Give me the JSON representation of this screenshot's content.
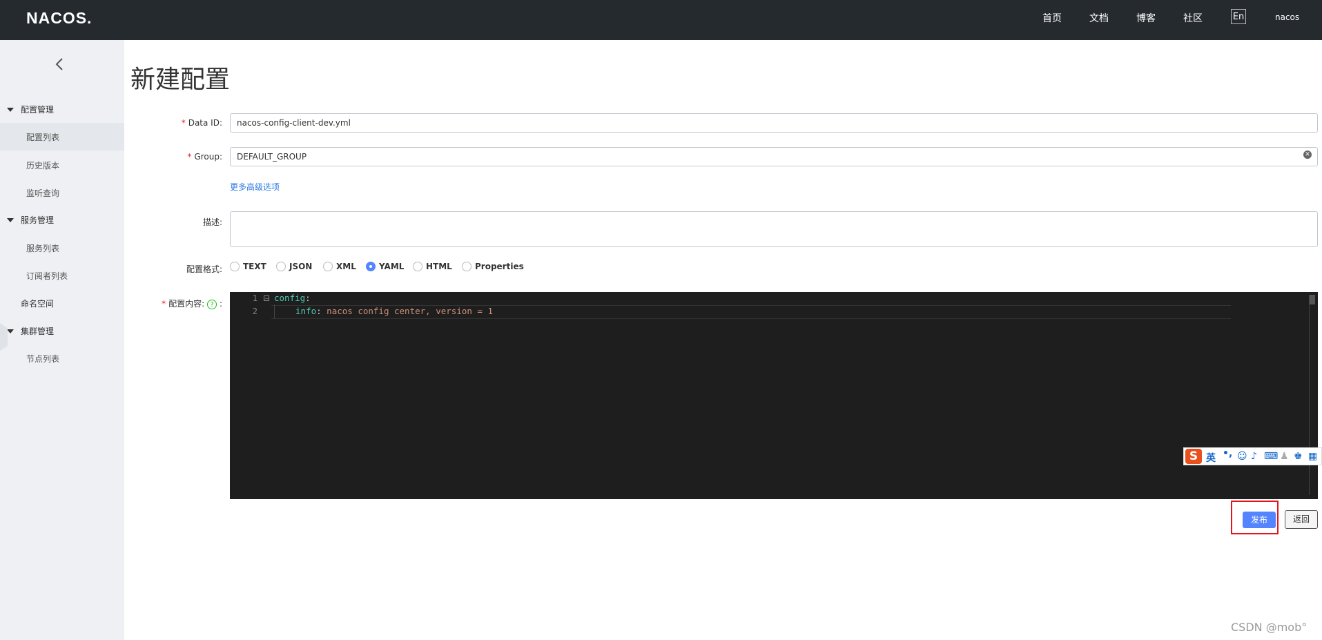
{
  "app": {
    "logo": "NACOS."
  },
  "topnav": {
    "items": [
      "首页",
      "文档",
      "博客",
      "社区"
    ],
    "lang": "En",
    "user": "nacos"
  },
  "sidebar": {
    "groups": [
      {
        "label": "配置管理",
        "items": [
          "配置列表",
          "历史版本",
          "监听查询"
        ]
      },
      {
        "label": "服务管理",
        "items": [
          "服务列表",
          "订阅者列表"
        ]
      },
      {
        "label": "命名空间",
        "items": []
      },
      {
        "label": "集群管理",
        "items": [
          "节点列表"
        ]
      }
    ]
  },
  "page": {
    "title": "新建配置"
  },
  "form": {
    "data_id": {
      "label": "Data ID:",
      "value": "nacos-config-client-dev.yml"
    },
    "group": {
      "label": "Group:",
      "value": "DEFAULT_GROUP"
    },
    "advanced_link": "更多高级选项",
    "description": {
      "label": "描述:",
      "value": ""
    },
    "format": {
      "label": "配置格式:",
      "options": [
        "TEXT",
        "JSON",
        "XML",
        "YAML",
        "HTML",
        "Properties"
      ],
      "selected": "YAML"
    },
    "content": {
      "label": "配置内容:",
      "help": "?",
      "colon": ":",
      "lines": [
        {
          "num": "1",
          "key": "config",
          "sep": ":",
          "value": ""
        },
        {
          "num": "2",
          "key": "info",
          "sep": ": ",
          "value": "nacos config center, version = 1"
        }
      ]
    }
  },
  "ime": {
    "s": "S",
    "lang": "英"
  },
  "actions": {
    "publish": "发布",
    "back": "返回"
  },
  "watermark": "CSDN @mob°"
}
